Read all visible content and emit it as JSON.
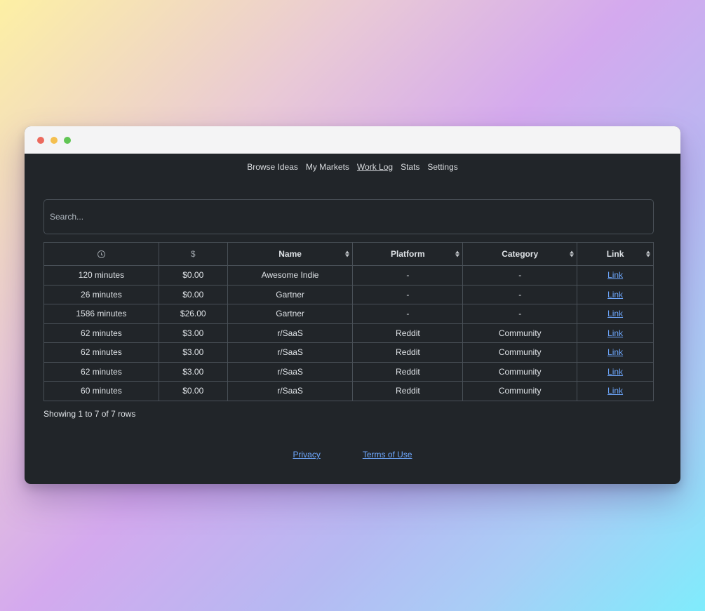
{
  "nav": {
    "items": [
      {
        "label": "Browse Ideas",
        "active": false
      },
      {
        "label": "My Markets",
        "active": false
      },
      {
        "label": "Work Log",
        "active": true
      },
      {
        "label": "Stats",
        "active": false
      },
      {
        "label": "Settings",
        "active": false
      }
    ]
  },
  "search": {
    "placeholder": "Search...",
    "value": ""
  },
  "table": {
    "headers": {
      "time_icon": "clock-icon",
      "cost": "$",
      "name": "Name",
      "platform": "Platform",
      "category": "Category",
      "link": "Link"
    },
    "rows": [
      {
        "time": "120 minutes",
        "cost": "$0.00",
        "name": "Awesome Indie",
        "platform": "-",
        "category": "-",
        "link": "Link"
      },
      {
        "time": "26 minutes",
        "cost": "$0.00",
        "name": "Gartner",
        "platform": "-",
        "category": "-",
        "link": "Link"
      },
      {
        "time": "1586 minutes",
        "cost": "$26.00",
        "name": "Gartner",
        "platform": "-",
        "category": "-",
        "link": "Link"
      },
      {
        "time": "62 minutes",
        "cost": "$3.00",
        "name": "r/SaaS",
        "platform": "Reddit",
        "category": "Community",
        "link": "Link"
      },
      {
        "time": "62 minutes",
        "cost": "$3.00",
        "name": "r/SaaS",
        "platform": "Reddit",
        "category": "Community",
        "link": "Link"
      },
      {
        "time": "62 minutes",
        "cost": "$3.00",
        "name": "r/SaaS",
        "platform": "Reddit",
        "category": "Community",
        "link": "Link"
      },
      {
        "time": "60 minutes",
        "cost": "$0.00",
        "name": "r/SaaS",
        "platform": "Reddit",
        "category": "Community",
        "link": "Link"
      }
    ]
  },
  "summary": "Showing 1 to 7 of 7 rows",
  "footer": {
    "privacy": "Privacy",
    "terms": "Terms of Use"
  },
  "colors": {
    "link": "#6ea8fe",
    "background": "#212529",
    "border": "#495057"
  }
}
